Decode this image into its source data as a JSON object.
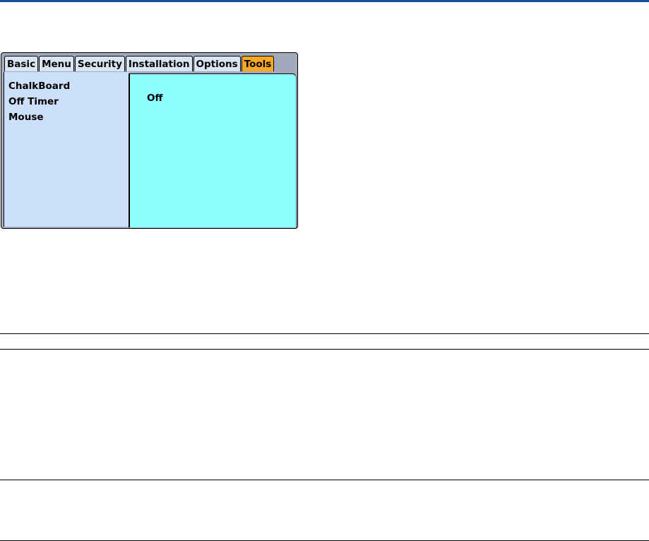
{
  "osd_menu": {
    "tabs": [
      {
        "label": "Basic",
        "active": false
      },
      {
        "label": "Menu",
        "active": false
      },
      {
        "label": "Security",
        "active": false
      },
      {
        "label": "Installation",
        "active": false
      },
      {
        "label": "Options",
        "active": false
      },
      {
        "label": "Tools",
        "active": true
      }
    ],
    "items": [
      {
        "label": "ChalkBoard"
      },
      {
        "label": "Off Timer"
      },
      {
        "label": "Mouse"
      }
    ],
    "selected_value": "Off",
    "colors": {
      "window_frame": "#a0aabb",
      "tab_bg": "#d9e4f2",
      "active_tab_bg": "#f9a825",
      "list_bg": "#cde0fb",
      "value_pane_bg": "#8cffff",
      "top_rule": "#1a4f9c"
    }
  }
}
